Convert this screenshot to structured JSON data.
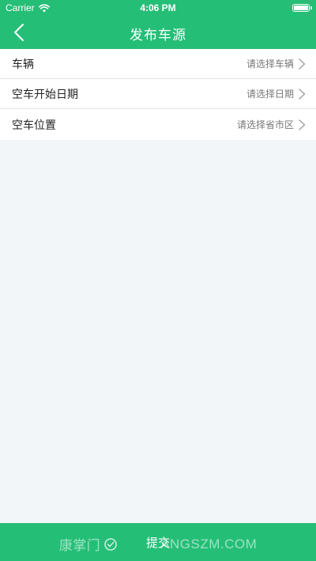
{
  "status_bar": {
    "carrier": "Carrier",
    "time": "4:06 PM",
    "battery_level": 1.0
  },
  "nav": {
    "title": "发布车源",
    "back_icon": "chevron-left-icon"
  },
  "form": {
    "rows": [
      {
        "label": "车辆",
        "placeholder": "请选择车辆"
      },
      {
        "label": "空车开始日期",
        "placeholder": "请选择日期"
      },
      {
        "label": "空车位置",
        "placeholder": "请选择省市区"
      }
    ]
  },
  "submit": {
    "label": "提交"
  },
  "watermark": {
    "left": "康掌门",
    "right": "ANGSZM.COM"
  },
  "colors": {
    "primary": "#25be77",
    "background": "#f2f6f9",
    "divider": "#e4e4e4"
  }
}
